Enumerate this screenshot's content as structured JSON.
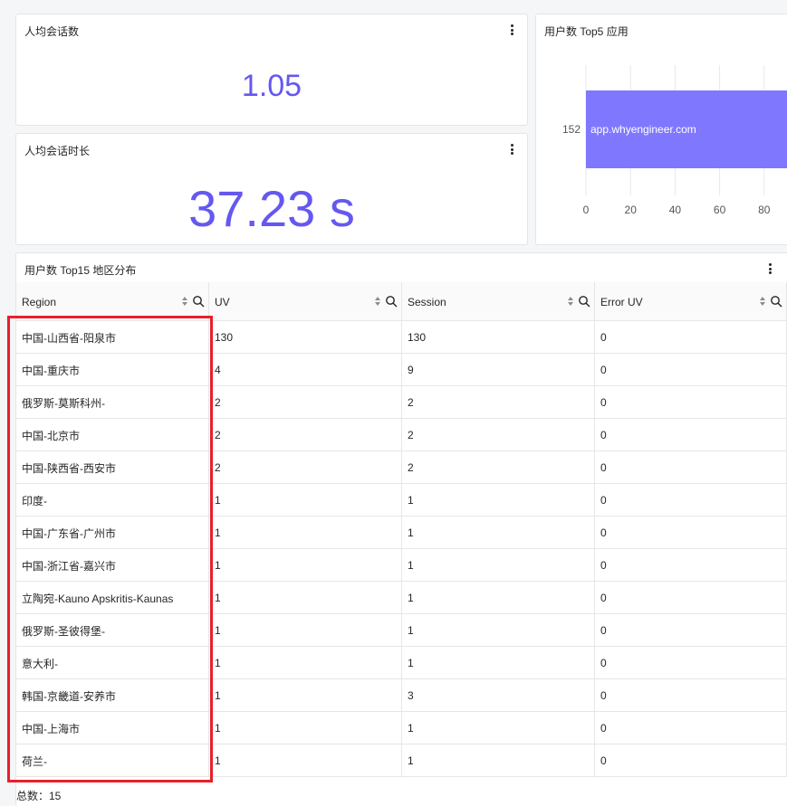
{
  "cards": {
    "avg_sessions": {
      "title": "人均会话数",
      "value": "1.05"
    },
    "avg_duration": {
      "title": "人均会话时长",
      "value": "37.23 s"
    },
    "top_apps": {
      "title": "用户数 Top5 应用"
    },
    "top_regions": {
      "title": "用户数 Top15 地区分布"
    }
  },
  "chart_data": {
    "type": "bar",
    "orientation": "horizontal",
    "title": "用户数 Top5 应用",
    "categories": [
      "152"
    ],
    "series": [
      {
        "values": [
          152
        ],
        "labels": [
          "app.whyengineer.com"
        ]
      }
    ],
    "x_ticks": [
      "0",
      "20",
      "40",
      "60",
      "80"
    ],
    "grid": true,
    "bar_color": "#8077ff"
  },
  "table": {
    "columns": [
      "Region",
      "UV",
      "Session",
      "Error UV"
    ],
    "rows": [
      [
        "中国-山西省-阳泉市",
        "130",
        "130",
        "0"
      ],
      [
        "中国-重庆市",
        "4",
        "9",
        "0"
      ],
      [
        "俄罗斯-莫斯科州-",
        "2",
        "2",
        "0"
      ],
      [
        "中国-北京市",
        "2",
        "2",
        "0"
      ],
      [
        "中国-陕西省-西安市",
        "2",
        "2",
        "0"
      ],
      [
        "印度-",
        "1",
        "1",
        "0"
      ],
      [
        "中国-广东省-广州市",
        "1",
        "1",
        "0"
      ],
      [
        "中国-浙江省-嘉兴市",
        "1",
        "1",
        "0"
      ],
      [
        "立陶宛-Kauno Apskritis-Kaunas",
        "1",
        "1",
        "0"
      ],
      [
        "俄罗斯-圣彼得堡-",
        "1",
        "1",
        "0"
      ],
      [
        "意大利-",
        "1",
        "1",
        "0"
      ],
      [
        "韩国-京畿道-安养市",
        "1",
        "3",
        "0"
      ],
      [
        "中国-上海市",
        "1",
        "1",
        "0"
      ],
      [
        "荷兰-",
        "1",
        "1",
        "0"
      ]
    ],
    "total_label": "总数：15"
  },
  "colors": {
    "accent": "#6558f0",
    "bar": "#8077ff",
    "highlight": "#e8202a"
  },
  "icons": [
    "more-vertical-icon",
    "sort-icon",
    "search-icon"
  ]
}
